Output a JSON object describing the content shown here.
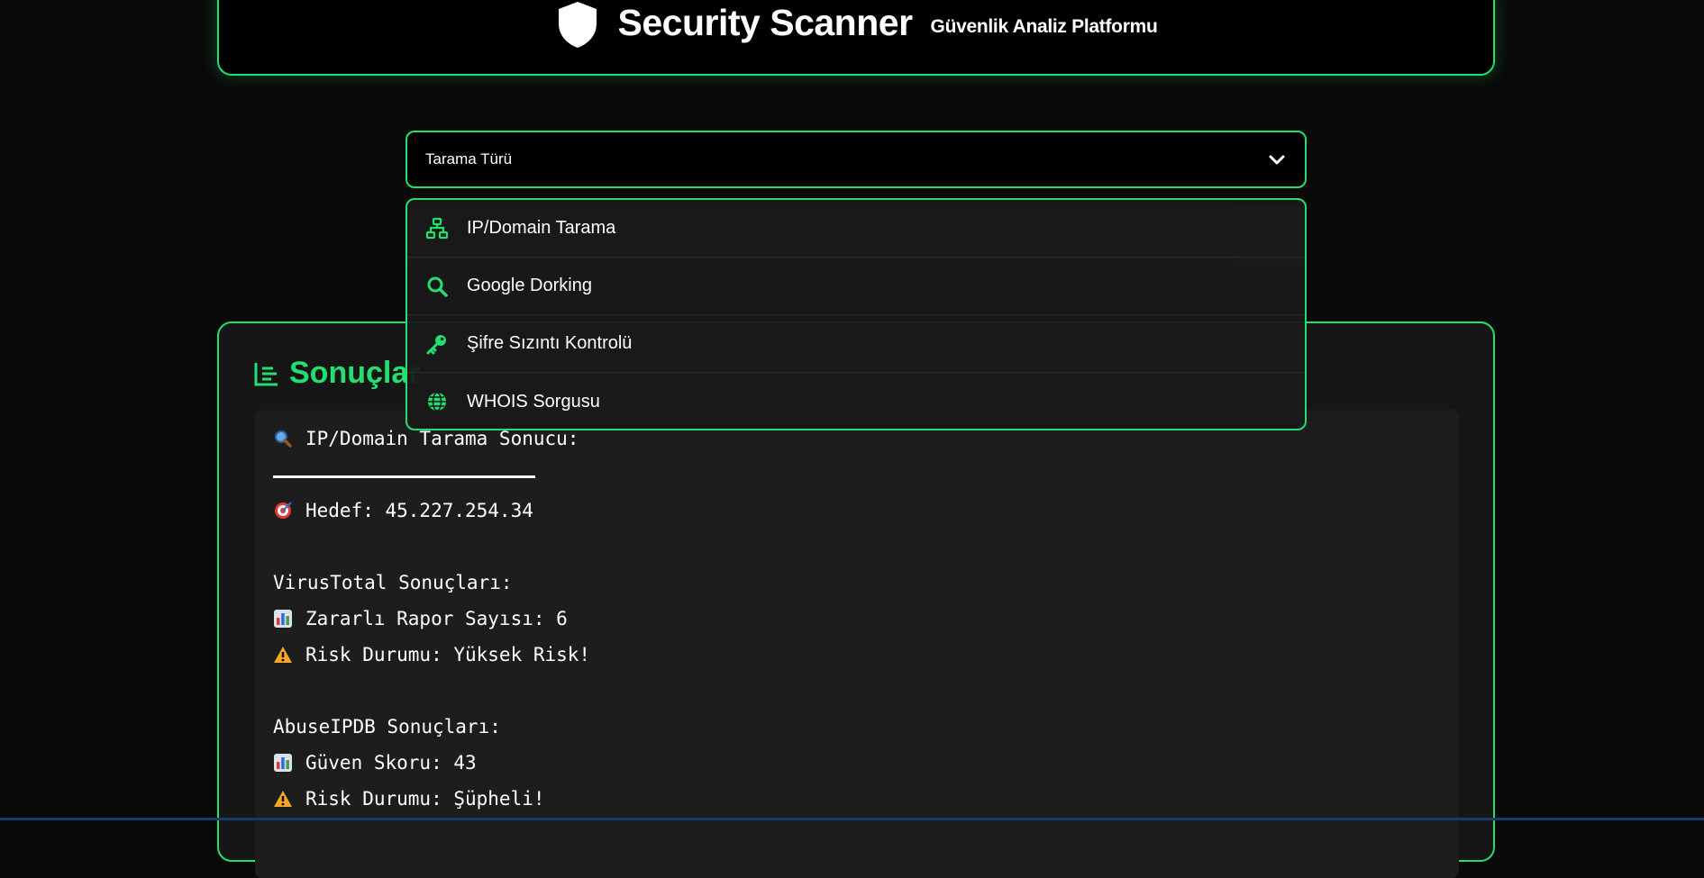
{
  "header": {
    "title": "Security Scanner",
    "subtitle": "Güvenlik Analiz Platformu",
    "icon": "shield-icon"
  },
  "scan_select": {
    "value": "Tarama Türü",
    "icon": "chevron-down-icon"
  },
  "search": {
    "placeholder": "",
    "button_icon": "search-icon"
  },
  "dropdown": {
    "items": [
      {
        "label": "IP/Domain Tarama",
        "icon": "network-icon"
      },
      {
        "label": "Google Dorking",
        "icon": "search-icon"
      },
      {
        "label": "Şifre Sızıntı Kontrolü",
        "icon": "key-icon"
      },
      {
        "label": "WHOIS Sorgusu",
        "icon": "globe-icon"
      }
    ]
  },
  "results": {
    "title": "Sonuçlar",
    "lines": {
      "heading": "IP/Domain Tarama Sonucu:",
      "target": "Hedef: 45.227.254.34",
      "vt_header": "VirusTotal Sonuçları:",
      "vt_reports": "Zararlı Rapor Sayısı: 6",
      "vt_risk": "Risk Durumu: Yüksek Risk!",
      "abuse_header": "AbuseIPDB Sonuçları:",
      "abuse_score": "Güven Skoru: 43",
      "abuse_risk": "Risk Durumu: Şüpheli!"
    }
  },
  "colors": {
    "accent": "#22e06f",
    "background": "#0a0a0a",
    "panel": "#161616"
  }
}
